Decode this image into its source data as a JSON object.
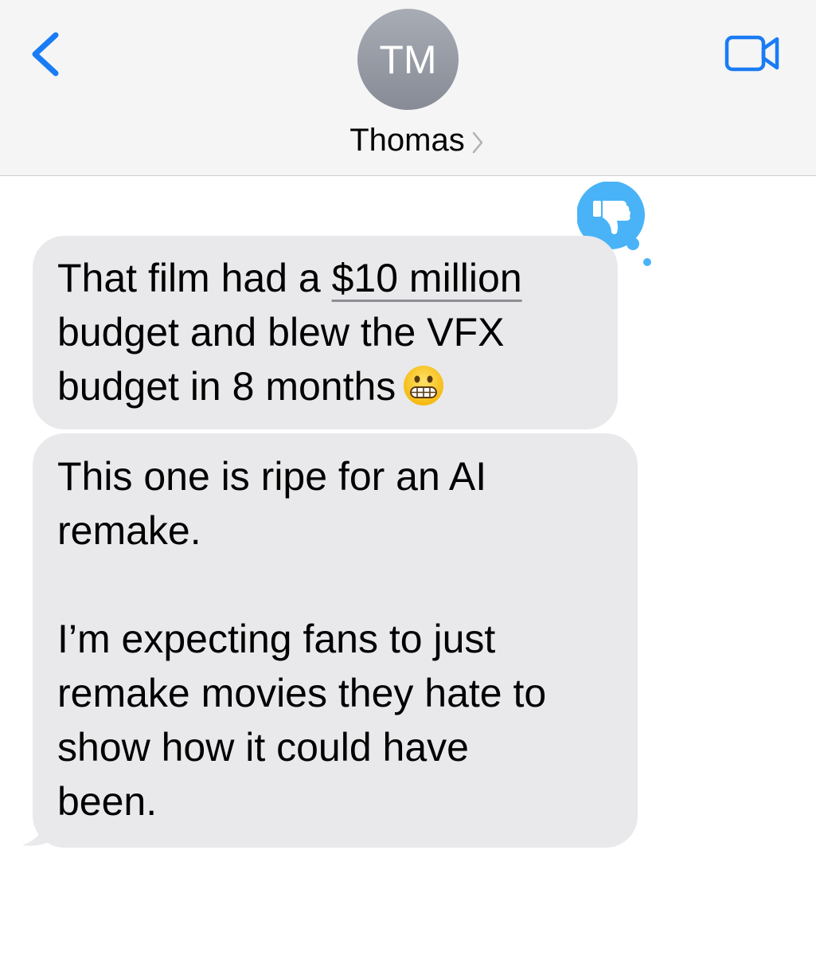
{
  "header": {
    "contact_initials": "TM",
    "contact_name": "Thomas",
    "back_icon": "chevron-left-icon",
    "video_icon": "video-camera-icon",
    "accent_color": "#1a7cf4"
  },
  "messages": [
    {
      "id": "msg-1",
      "lines": [
        "That film had a ",
        "$10 million",
        "budget and blew the VFX",
        "budget in 8 months"
      ],
      "emoji": "grimacing-face",
      "reaction": "thumbs-down-icon"
    },
    {
      "id": "msg-2",
      "lines": [
        "This one is ripe for an AI",
        "remake.",
        "I’m expecting fans to just",
        "remake movies they hate to",
        "show how it could have",
        "been."
      ]
    }
  ],
  "colors": {
    "incoming_bubble": "#e9e9eb",
    "header_background": "#f5f5f6",
    "reaction_bubble": "#4ab3f7"
  }
}
